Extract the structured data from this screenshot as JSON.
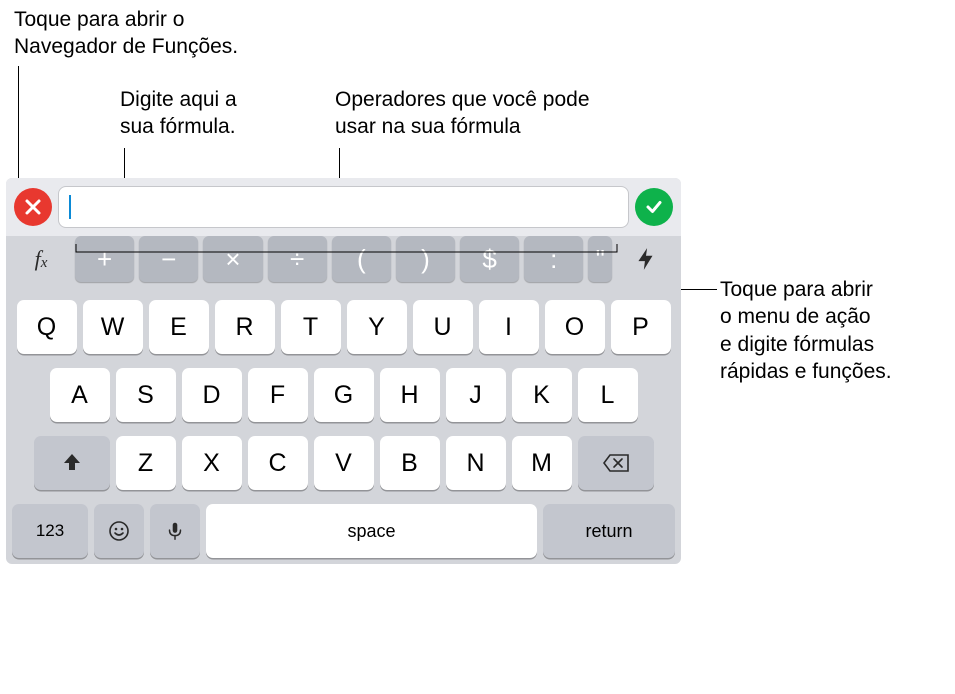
{
  "callouts": {
    "open_function_browser": "Toque para abrir o\nNavegador de Funções.",
    "type_formula": "Digite aqui a\nsua fórmula.",
    "operators": "Operadores que você pode\nusar na sua fórmula",
    "action_menu": "Toque para abrir\no menu de ação\ne digite fórmulas\nrápidas e funções."
  },
  "formula_bar": {
    "value": "",
    "cancel_label": "Cancelar",
    "confirm_label": "Confirmar"
  },
  "operator_row": {
    "fx_label": "fx",
    "operators": [
      "+",
      "−",
      "×",
      "÷",
      "(",
      ")",
      "$",
      ":",
      "\""
    ]
  },
  "keyboard": {
    "row1": [
      "Q",
      "W",
      "E",
      "R",
      "T",
      "Y",
      "U",
      "I",
      "O",
      "P"
    ],
    "row2": [
      "A",
      "S",
      "D",
      "F",
      "G",
      "H",
      "J",
      "K",
      "L"
    ],
    "row3": [
      "Z",
      "X",
      "C",
      "V",
      "B",
      "N",
      "M"
    ],
    "numbers_label": "123",
    "space_label": "space",
    "return_label": "return"
  },
  "icons": {
    "cancel": "x-icon",
    "confirm": "check-icon",
    "flash": "flash-icon",
    "shift": "shift-icon",
    "backspace": "backspace-icon",
    "emoji": "emoji-icon",
    "mic": "mic-icon"
  }
}
